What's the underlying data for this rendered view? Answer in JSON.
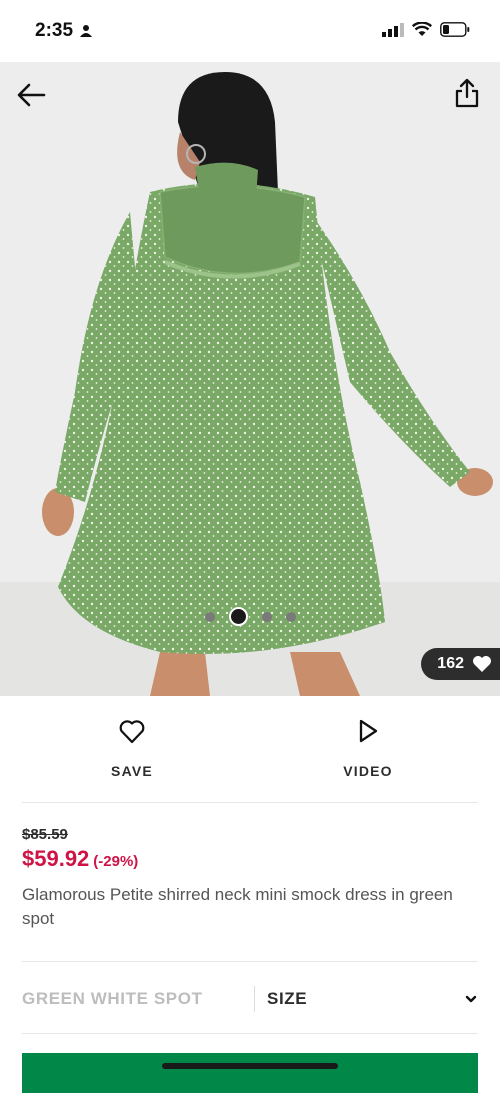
{
  "status_bar": {
    "time": "2:35"
  },
  "gallery": {
    "slide_count": 4,
    "active_slide": 2,
    "likes": "162"
  },
  "actions": {
    "save_label": "SAVE",
    "video_label": "VIDEO"
  },
  "product": {
    "old_price": "$85.59",
    "price": "$59.92",
    "discount": "(-29%)",
    "title": "Glamorous Petite shirred neck mini smock dress in green spot"
  },
  "selectors": {
    "colour": "GREEN WHITE SPOT",
    "size_label": "SIZE"
  },
  "colors": {
    "price_red": "#d01345",
    "cta_green": "#018849",
    "dress_green": "#7aa867"
  }
}
